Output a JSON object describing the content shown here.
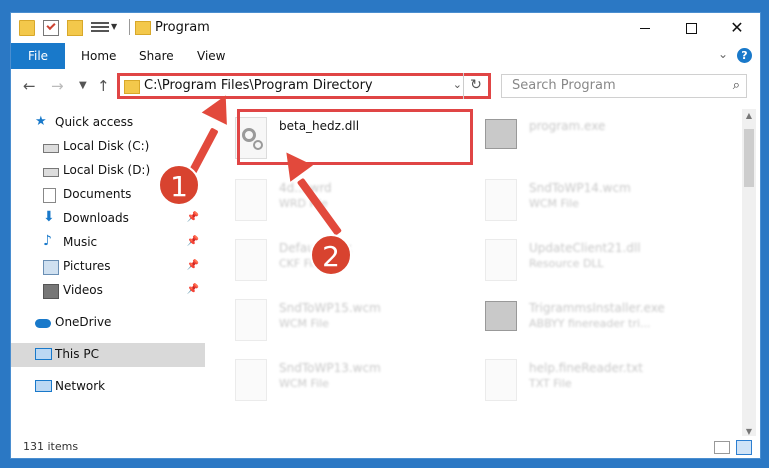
{
  "window": {
    "title": "Program",
    "controls": {
      "minimize": "minimize",
      "maximize": "maximize",
      "close": "✕"
    }
  },
  "ribbon": {
    "tabs": [
      "File",
      "Home",
      "Share",
      "View"
    ],
    "help": "?"
  },
  "address_bar": {
    "path": "C:\\Program Files\\Program Directory",
    "dropdown": "⌄",
    "refresh": "↻"
  },
  "search": {
    "placeholder": "Search Program"
  },
  "sidebar": {
    "items": [
      {
        "label": "Quick access",
        "icon": "star-icon",
        "pinned": false
      },
      {
        "label": "Local Disk (C:)",
        "icon": "drive-icon",
        "pinned": false
      },
      {
        "label": "Local Disk (D:)",
        "icon": "drive-icon",
        "pinned": false
      },
      {
        "label": "Documents",
        "icon": "documents-icon",
        "pinned": false
      },
      {
        "label": "Downloads",
        "icon": "download-icon",
        "pinned": true
      },
      {
        "label": "Music",
        "icon": "music-icon",
        "pinned": true
      },
      {
        "label": "Pictures",
        "icon": "pictures-icon",
        "pinned": true
      },
      {
        "label": "Videos",
        "icon": "videos-icon",
        "pinned": true
      },
      {
        "label": "OneDrive",
        "icon": "cloud-icon",
        "pinned": false
      },
      {
        "label": "This PC",
        "icon": "computer-icon",
        "pinned": false,
        "selected": true
      },
      {
        "label": "Network",
        "icon": "network-icon",
        "pinned": false
      }
    ]
  },
  "files": {
    "left": [
      {
        "name": "beta_hedz.dll",
        "sub": ""
      },
      {
        "name": "4d....wrd",
        "sub": "WRD File"
      },
      {
        "name": "Defau...t.cjk",
        "sub": "CKF File"
      },
      {
        "name": "SndToWP15.wcm",
        "sub": "WCM File"
      },
      {
        "name": "SndToWP13.wcm",
        "sub": "WCM File"
      }
    ],
    "right": [
      {
        "name": "program.exe",
        "sub": ""
      },
      {
        "name": "SndToWP14.wcm",
        "sub": "WCM File"
      },
      {
        "name": "UpdateClient21.dll",
        "sub": "Resource DLL"
      },
      {
        "name": "TrigrammsInstaller.exe",
        "sub": "ABBYY finereader tri..."
      },
      {
        "name": "help.fineReader.txt",
        "sub": "TXT File"
      }
    ]
  },
  "status": {
    "items": "131 items"
  },
  "annotations": {
    "step1": "1",
    "step2": "2"
  },
  "colors": {
    "accent": "#1979ca",
    "highlight": "#e04545",
    "desktop": "#2b78c4"
  }
}
